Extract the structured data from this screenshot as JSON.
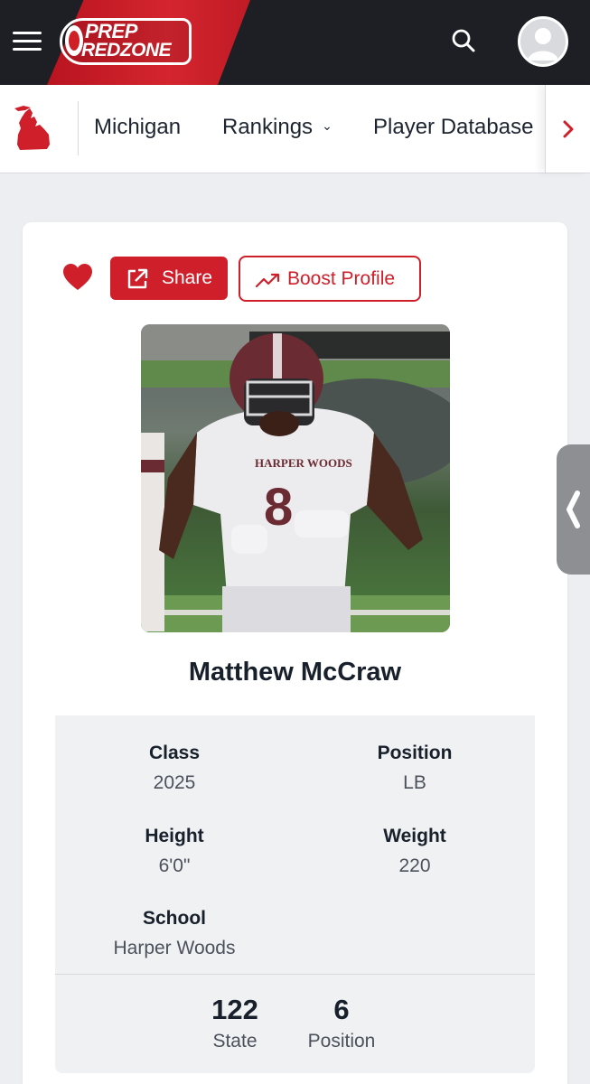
{
  "header": {
    "logo_line1": "PREP",
    "logo_line2": "REDZONE",
    "menu_icon": "hamburger-icon",
    "search_icon": "search-icon",
    "avatar_icon": "user-avatar-icon"
  },
  "subnav": {
    "state_icon": "michigan-map-icon",
    "items": [
      {
        "label": "Michigan"
      },
      {
        "label": "Rankings"
      },
      {
        "label": "Player Database"
      }
    ],
    "next_icon": "chevron-right-icon"
  },
  "profile": {
    "favorite_icon": "heart-icon",
    "share_label": "Share",
    "share_icon": "external-link-icon",
    "boost_label": "Boost Profile",
    "boost_icon": "trending-up-icon",
    "name": "Matthew McCraw",
    "details": {
      "class_label": "Class",
      "class_value": "2025",
      "position_label": "Position",
      "position_value": "LB",
      "height_label": "Height",
      "height_value": "6'0\"",
      "weight_label": "Weight",
      "weight_value": "220",
      "school_label": "School",
      "school_value": "Harper Woods"
    },
    "rankings": {
      "state_rank": "122",
      "state_label": "State",
      "position_rank": "6",
      "position_label": "Position"
    }
  },
  "side_tab_icon": "chevron-left-icon",
  "colors": {
    "brand_red": "#cf1f2a",
    "header_dark": "#1d1f24",
    "page_bg": "#eceef1",
    "stats_bg": "#f0f1f3"
  }
}
